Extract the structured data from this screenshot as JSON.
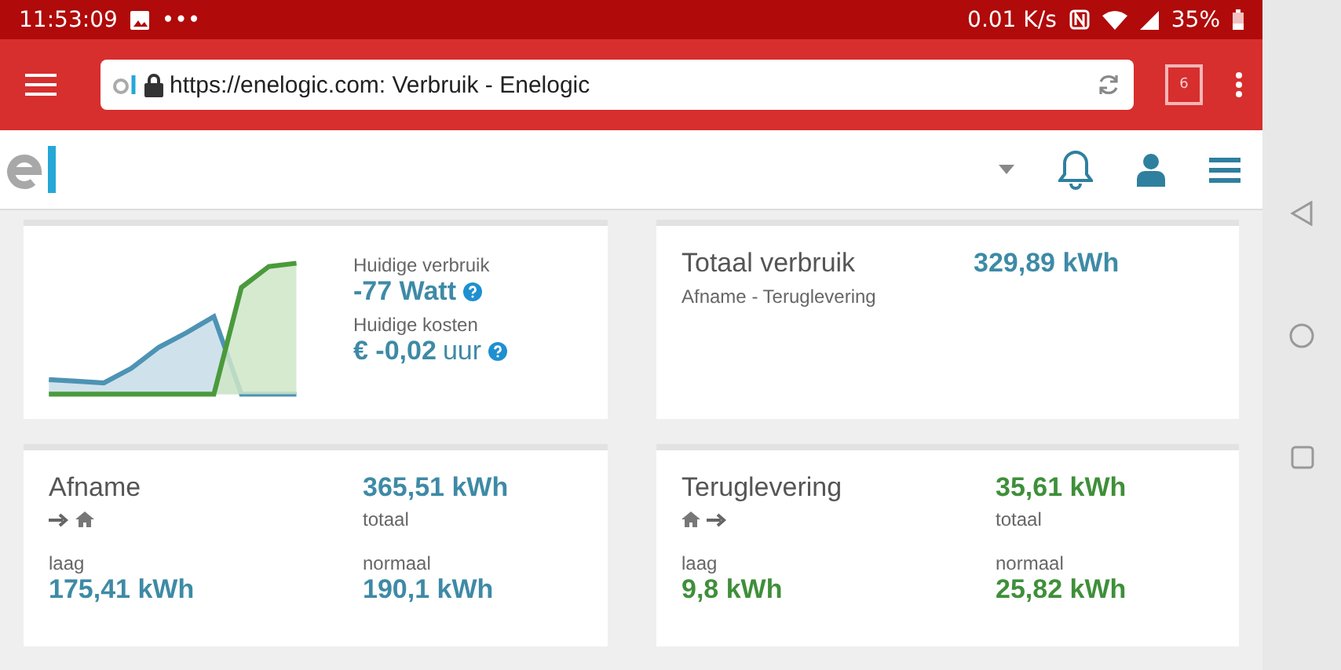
{
  "status_bar": {
    "time": "11:53:09",
    "more": "•••",
    "speed": "0.01 K/s",
    "battery": "35%"
  },
  "browser": {
    "url": "https://enelogic.com: Verbruik - Enelogic",
    "tab_count": "6"
  },
  "current": {
    "usage_label": "Huidige verbruik",
    "usage_value": "-77 Watt",
    "cost_label": "Huidige kosten",
    "cost_value": "€ -0,02",
    "cost_unit": "uur"
  },
  "total": {
    "title": "Totaal verbruik",
    "subtitle": "Afname - Teruglevering",
    "value": "329,89 kWh"
  },
  "meters": [
    {
      "kind": "import",
      "title": "Afname",
      "color": "#3e8aa6",
      "total_value": "365,51 kWh",
      "total_label": "totaal",
      "low_label": "laag",
      "low_value": "175,41 kWh",
      "normal_label": "normaal",
      "normal_value": "190,1 kWh"
    },
    {
      "kind": "export",
      "title": "Teruglevering",
      "color": "#3f8f3a",
      "total_value": "35,61 kWh",
      "total_label": "totaal",
      "low_label": "laag",
      "low_value": "9,8 kWh",
      "normal_label": "normaal",
      "normal_value": "25,82 kWh"
    }
  ]
}
